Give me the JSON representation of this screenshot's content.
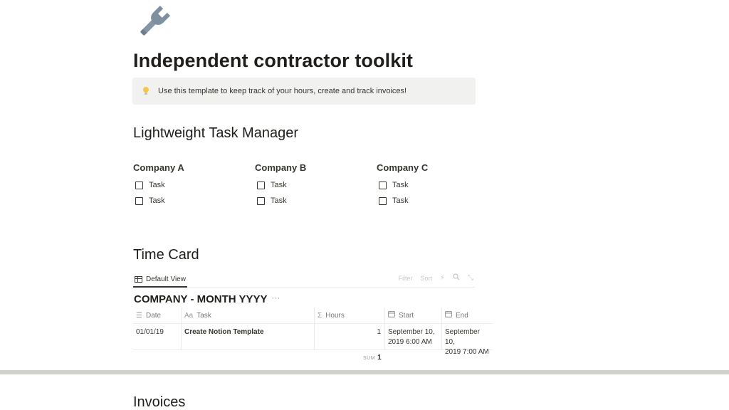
{
  "page": {
    "icon": "wrench-icon",
    "title": "Independent contractor toolkit"
  },
  "callout": {
    "icon": "lightbulb-icon",
    "text": "Use this template to keep track of your hours, create and track invoices!"
  },
  "task_manager": {
    "heading": "Lightweight Task Manager",
    "companies": [
      {
        "name": "Company A",
        "tasks": [
          "Task",
          "Task"
        ]
      },
      {
        "name": "Company B",
        "tasks": [
          "Task",
          "Task"
        ]
      },
      {
        "name": "Company C",
        "tasks": [
          "Task",
          "Task"
        ]
      }
    ]
  },
  "time_card": {
    "heading": "Time Card",
    "view_tab": "Default View",
    "actions": [
      "Filter",
      "Sort"
    ],
    "db_title": "COMPANY - MONTH YYYY",
    "db_more": "···",
    "columns": [
      {
        "icon": "list-icon",
        "label": "Date"
      },
      {
        "icon": "Aa",
        "label": "Task"
      },
      {
        "icon": "Σ",
        "label": "Hours"
      },
      {
        "icon": "calendar-icon",
        "label": "Start"
      },
      {
        "icon": "calendar-icon",
        "label": "End"
      }
    ],
    "rows": [
      {
        "date": "01/01/19",
        "task": "Create Notion Template",
        "hours": "1",
        "start_1": "September 10,",
        "start_2": "2019 6:00 AM",
        "end_1": "September 10,",
        "end_2": "2019 7:00 AM"
      }
    ],
    "sum_label": "SUM",
    "sum_value": "1"
  },
  "invoices": {
    "heading": "Invoices"
  }
}
